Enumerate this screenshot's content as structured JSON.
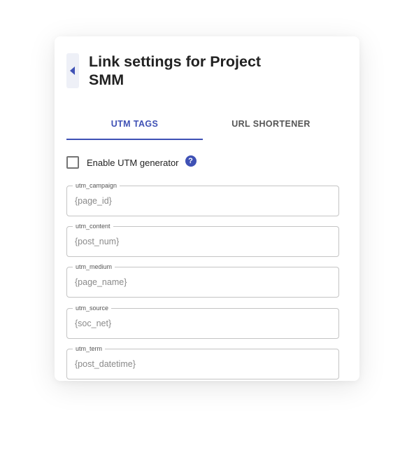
{
  "dialog": {
    "title": "Link settings for Project SMM",
    "back_icon": "chevron-left-icon"
  },
  "tabs": [
    {
      "label": "UTM TAGS",
      "active": true
    },
    {
      "label": "URL SHORTENER",
      "active": false
    }
  ],
  "utm": {
    "enable_label": "Enable UTM generator",
    "enabled": false,
    "help_icon": "?",
    "fields": [
      {
        "label": "utm_campaign",
        "placeholder": "{page_id}"
      },
      {
        "label": "utm_content",
        "placeholder": "{post_num}"
      },
      {
        "label": "utm_medium",
        "placeholder": "{page_name}"
      },
      {
        "label": "utm_source",
        "placeholder": "{soc_net}"
      },
      {
        "label": "utm_term",
        "placeholder": "{post_datetime}"
      }
    ]
  },
  "colors": {
    "accent": "#3f51b5",
    "border": "#c4c4c4"
  }
}
